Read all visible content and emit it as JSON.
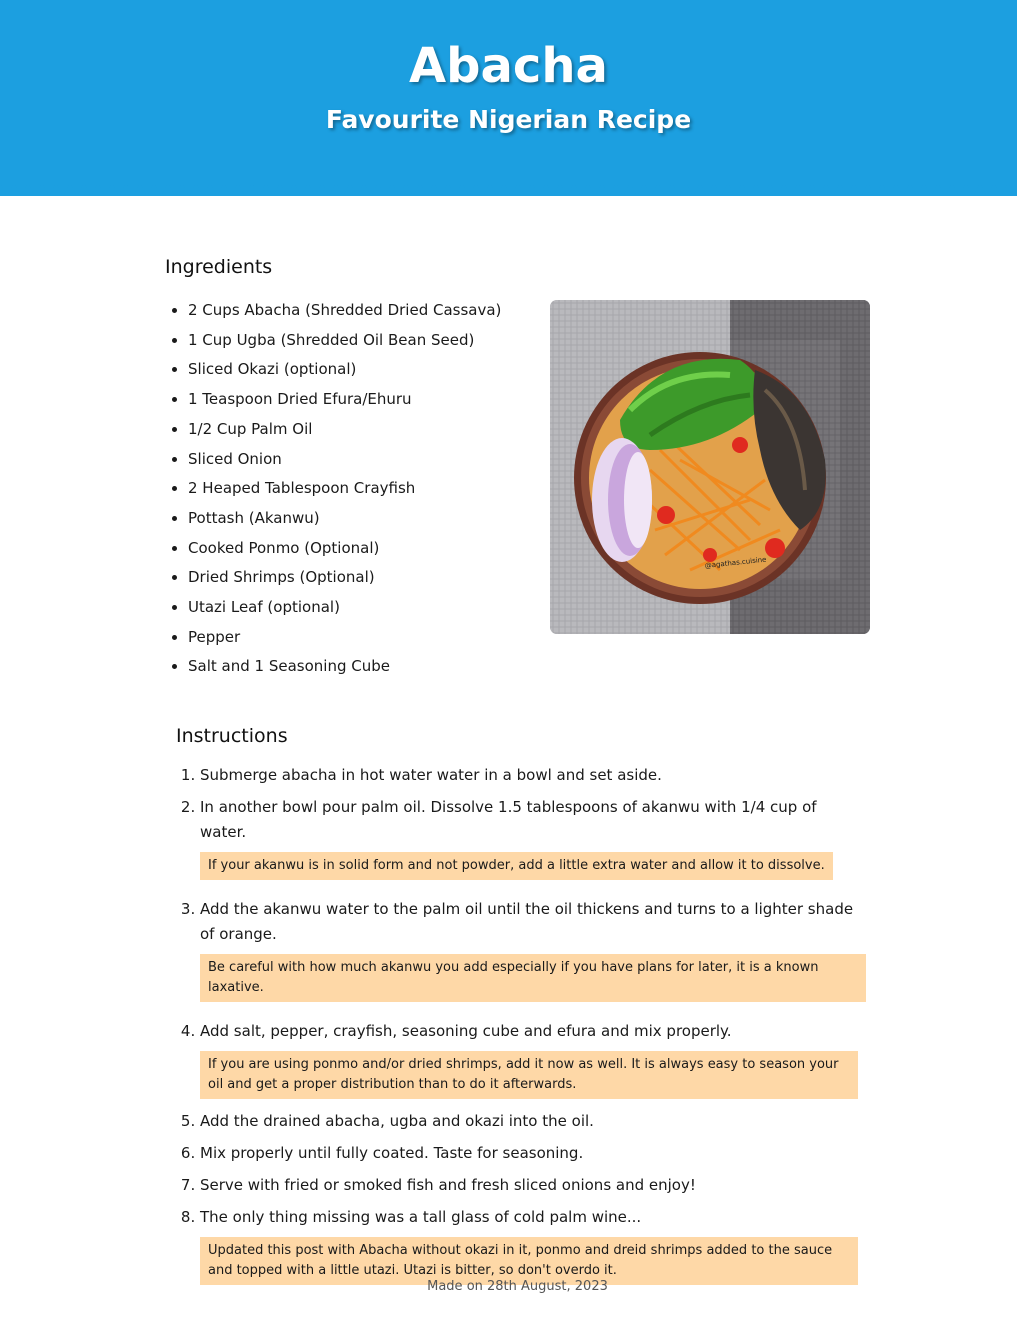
{
  "header": {
    "title": "Abacha",
    "subtitle": "Favourite Nigerian Recipe",
    "background_color": "#1c9fe0"
  },
  "ingredients": {
    "heading": "Ingredients",
    "items": [
      "2 Cups Abacha (Shredded Dried Cassava)",
      "1 Cup Ugba (Shredded Oil Bean Seed)",
      "Sliced Okazi (optional)",
      "1 Teaspoon Dried Efura/Ehuru",
      "1/2 Cup Palm Oil",
      "Sliced Onion",
      "2 Heaped Tablespoon Crayfish",
      "Pottash (Akanwu)",
      "Cooked Ponmo (Optional)",
      "Dried Shrimps (Optional)",
      "Utazi Leaf (optional)",
      "Pepper",
      "Salt and 1 Seasoning Cube"
    ]
  },
  "photo": {
    "watermark": "@agathas.cuisine"
  },
  "instructions": {
    "heading": "Instructions",
    "steps": [
      {
        "text": "Submerge abacha in hot water water in a bowl and set aside."
      },
      {
        "text": "In another bowl pour palm oil. Dissolve 1.5 tablespoons of akanwu with 1/4 cup of water.",
        "note": "If your akanwu is in solid form and not powder, add a little extra water and allow it to dissolve."
      },
      {
        "text": "Add the akanwu water to the palm oil until the oil thickens and turns to a lighter shade of orange.",
        "note": "Be careful with how much akanwu you add especially if you have plans for later, it is a known laxative."
      },
      {
        "text": "Add salt, pepper, crayfish, seasoning cube and efura and mix properly.",
        "note": "If you are using ponmo and/or dried shrimps, add it now as well. It is always easy to season your oil and get a proper distribution than to do it afterwards."
      },
      {
        "text": "Add the drained abacha, ugba and okazi into the oil."
      },
      {
        "text": "Mix properly until fully coated. Taste for seasoning."
      },
      {
        "text": "Serve with fried or smoked fish and fresh sliced onions and enjoy!"
      },
      {
        "text": "The only thing missing was a tall glass of cold palm wine...",
        "note": "Updated this post with Abacha without okazi in it, ponmo and dreid shrimps added to the sauce and topped with a little utazi. Utazi is bitter, so don't overdo it."
      }
    ],
    "note_color": "#fed8a7"
  },
  "footer": {
    "text": "Made on 28th August, 2023"
  }
}
